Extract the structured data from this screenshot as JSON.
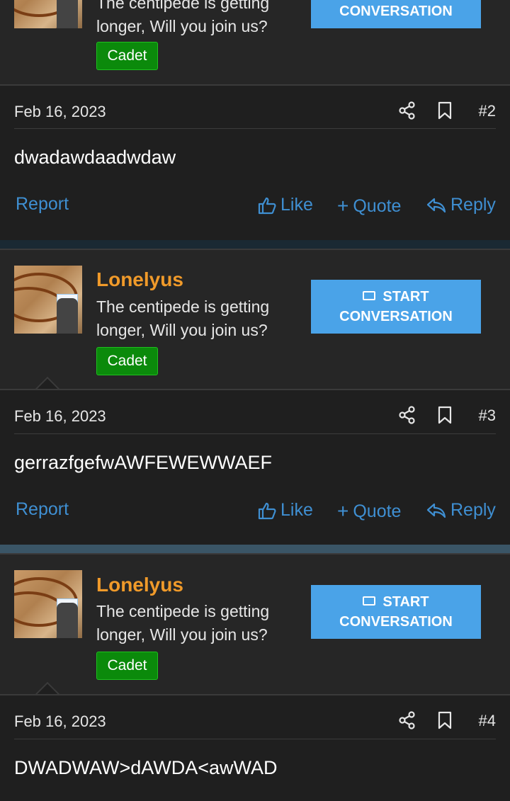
{
  "top_user": {
    "title_partial": "The centipede is getting",
    "title_line2": "longer, Will you join us?",
    "badge": "Cadet",
    "start_button": "CONVERSATION"
  },
  "posts": [
    {
      "date": "Feb 16, 2023",
      "number": "#2",
      "message": "dwadawdaadwdaw",
      "report": "Report",
      "like": "Like",
      "quote": "Quote",
      "reply": "Reply"
    },
    {
      "date": "Feb 16, 2023",
      "number": "#3",
      "message": "gerrazfgefwAWFEWEWWAEF",
      "report": "Report",
      "like": "Like",
      "quote": "Quote",
      "reply": "Reply"
    },
    {
      "date": "Feb 16, 2023",
      "number": "#4",
      "message": "DWADWAW>dAWDA<awWAD"
    }
  ],
  "users": [
    {
      "name": "Lonelyus",
      "title_line1": "The centipede is getting",
      "title_line2": "longer, Will you join us?",
      "badge": "Cadet",
      "start_line1": "START",
      "start_line2": "CONVERSATION"
    },
    {
      "name": "Lonelyus",
      "title_line1": "The centipede is getting",
      "title_line2": "longer, Will you join us?",
      "badge": "Cadet",
      "start_line1": "START",
      "start_line2": "CONVERSATION"
    }
  ],
  "colors": {
    "accent": "#4aa3e8",
    "link": "#3f8fd2",
    "username": "#f09a2a",
    "badge": "#0b8a0b"
  }
}
